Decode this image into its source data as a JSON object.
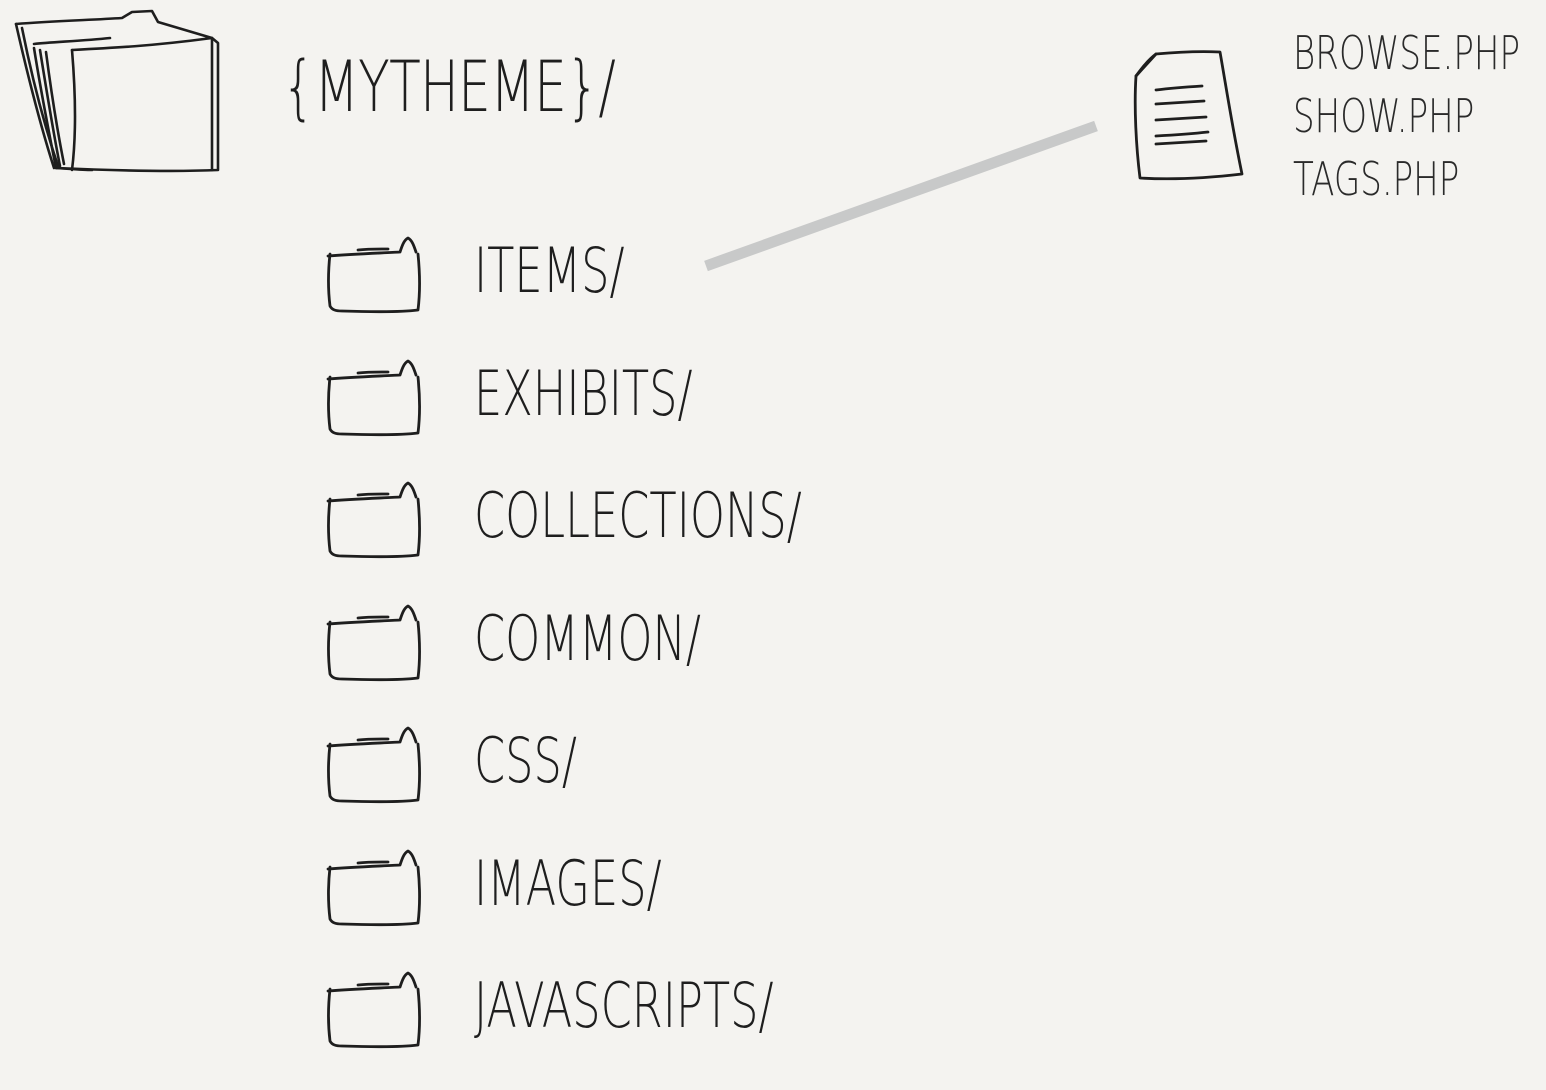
{
  "root": {
    "label": "{MYTHEME}/",
    "icon": "folder-open-icon"
  },
  "folders": [
    {
      "label": "ITEMS/",
      "icon": "folder-icon"
    },
    {
      "label": "EXHIBITS/",
      "icon": "folder-icon"
    },
    {
      "label": "COLLECTIONS/",
      "icon": "folder-icon"
    },
    {
      "label": "COMMON/",
      "icon": "folder-icon"
    },
    {
      "label": "CSS/",
      "icon": "folder-icon"
    },
    {
      "label": "IMAGES/",
      "icon": "folder-icon"
    },
    {
      "label": "JAVASCRIPTS/",
      "icon": "folder-icon"
    }
  ],
  "items_files": {
    "icon": "document-icon",
    "files": [
      "BROWSE.PHP",
      "SHOW.PHP",
      "TAGS.PHP"
    ]
  },
  "colors": {
    "background": "#f4f3f0",
    "ink": "#1e1e1e",
    "connector": "#c8c9c9"
  }
}
